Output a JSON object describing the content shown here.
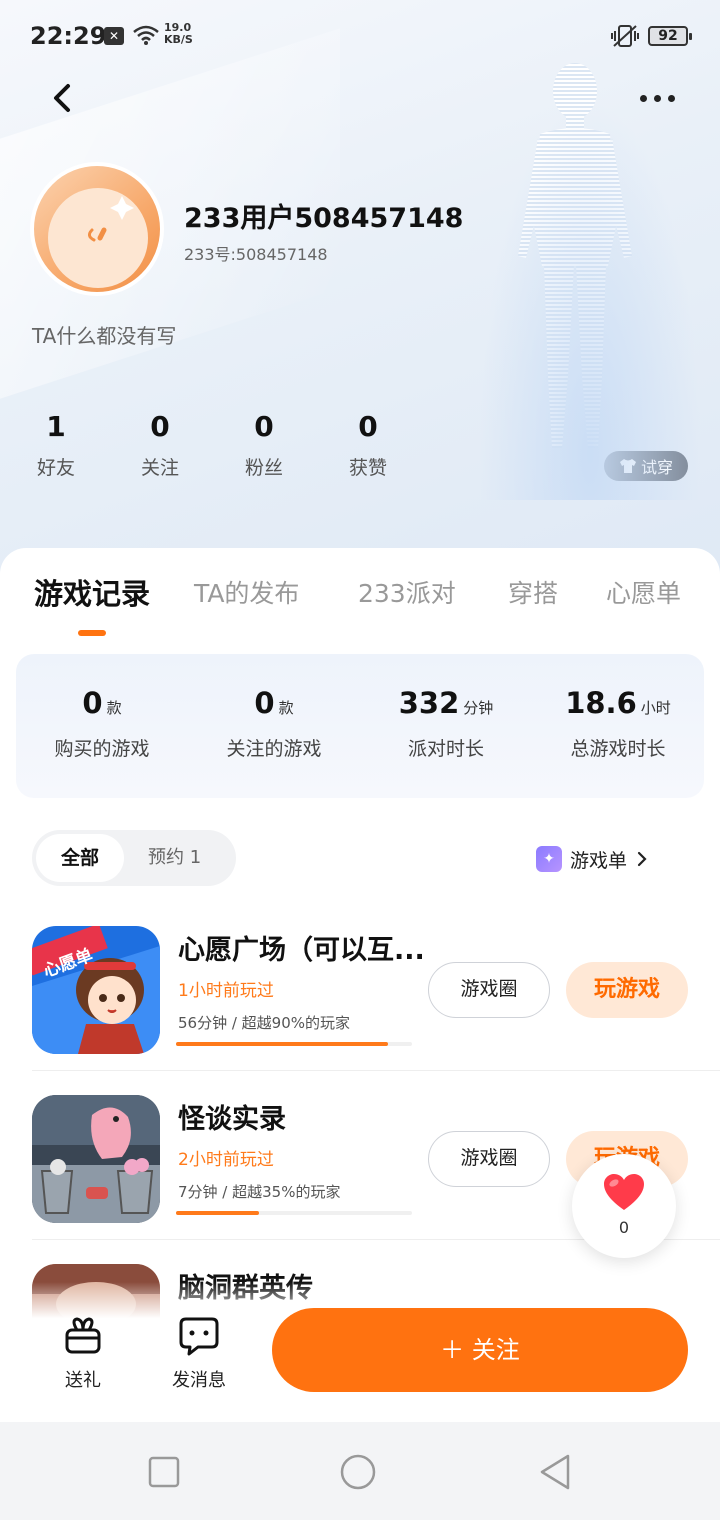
{
  "status_bar": {
    "time": "22:29",
    "network_speed_value": "19.0",
    "network_speed_unit": "KB/S",
    "battery": "92"
  },
  "profile": {
    "username": "233用户508457148",
    "user_id": "233号:508457148",
    "bio": "TA什么都没有写",
    "stats": [
      {
        "value": "1",
        "label": "好友"
      },
      {
        "value": "0",
        "label": "关注"
      },
      {
        "value": "0",
        "label": "粉丝"
      },
      {
        "value": "0",
        "label": "获赞"
      }
    ],
    "try_on_label": "试穿"
  },
  "tabs": [
    {
      "label": "游戏记录",
      "active": true
    },
    {
      "label": "TA的发布",
      "active": false
    },
    {
      "label": "233派对",
      "active": false
    },
    {
      "label": "穿搭",
      "active": false
    },
    {
      "label": "心愿单",
      "active": false
    }
  ],
  "summary": [
    {
      "value": "0",
      "unit": "款",
      "label": "购买的游戏"
    },
    {
      "value": "0",
      "unit": "款",
      "label": "关注的游戏"
    },
    {
      "value": "332",
      "unit": "分钟",
      "label": "派对时长"
    },
    {
      "value": "18.6",
      "unit": "小时",
      "label": "总游戏时长"
    }
  ],
  "filter": {
    "all_label": "全部",
    "reserve_label": "预约",
    "reserve_count": "1",
    "game_list_label": "游戏单"
  },
  "games": [
    {
      "title": "心愿广场（可以互...",
      "last_played": "1小时前玩过",
      "play_time": "56分钟 / 超越90%的玩家",
      "progress": 0.9,
      "icon_badge": "心愿单",
      "circle_label": "游戏圈",
      "play_label": "玩游戏"
    },
    {
      "title": "怪谈实录",
      "last_played": "2小时前玩过",
      "play_time": "7分钟 / 超越35%的玩家",
      "progress": 0.35,
      "circle_label": "游戏圈",
      "play_label": "玩游戏"
    },
    {
      "title": "脑洞群英传"
    }
  ],
  "like": {
    "count": "0"
  },
  "bottom_bar": {
    "gift_label": "送礼",
    "message_label": "发消息",
    "follow_label": "＋ 关注"
  },
  "colors": {
    "accent": "#ff7210",
    "accent_light": "#ffe8d6",
    "like_red": "#ff3b4a"
  }
}
